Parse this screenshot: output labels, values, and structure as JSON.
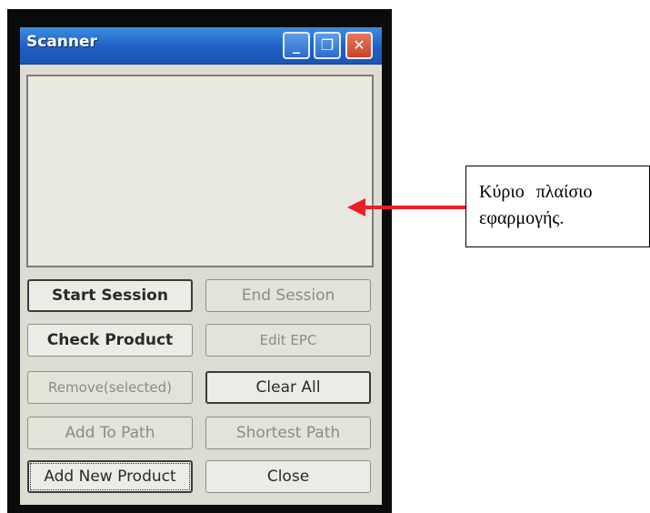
{
  "window": {
    "title": "Scanner",
    "minimize_glyph": "_",
    "restore_glyph": "❐",
    "close_glyph": "✕"
  },
  "buttons": {
    "start_session": "Start Session",
    "end_session": "End Session",
    "check_product": "Check Product",
    "edit_epc": "Edit EPC",
    "remove_selected": "Remove(selected)",
    "clear_all": "Clear All",
    "add_to_path": "Add To Path",
    "shortest_path": "Shortest Path",
    "add_new_product": "Add New Product",
    "close": "Close"
  },
  "annotation": {
    "line1": "Κύριο πλαίσιο",
    "line2": "εφαρμογής.",
    "arrow_color": "#ee1c24"
  },
  "colors": {
    "titlebar": "#1f5fc4",
    "close_button": "#c8432a"
  },
  "icons": [
    "minimize-icon",
    "restore-icon",
    "close-icon",
    "arrow-left-icon"
  ]
}
